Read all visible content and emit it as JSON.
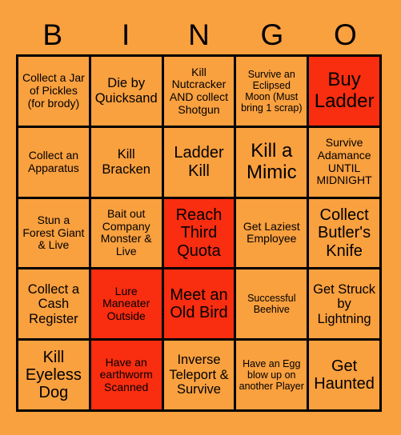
{
  "card": {
    "header_letters": [
      "B",
      "I",
      "N",
      "G",
      "O"
    ],
    "colors": {
      "background": "#f9a03f",
      "cell_unmarked": "#f9a03f",
      "cell_marked": "#f92d10",
      "border": "#000000",
      "text": "#000000"
    },
    "rows": [
      [
        {
          "text": "Collect a Jar of Pickles (for brody)",
          "marked": false,
          "size": "s"
        },
        {
          "text": "Die by Quicksand",
          "marked": false,
          "size": "m"
        },
        {
          "text": "Kill Nutcracker AND collect Shotgun",
          "marked": false,
          "size": "s"
        },
        {
          "text": "Survive an Eclipsed Moon (Must bring 1 scrap)",
          "marked": false,
          "size": "xs"
        },
        {
          "text": "Buy Ladder",
          "marked": true,
          "size": "xl"
        }
      ],
      [
        {
          "text": "Collect an Apparatus",
          "marked": false,
          "size": "s"
        },
        {
          "text": "Kill Bracken",
          "marked": false,
          "size": "m"
        },
        {
          "text": "Ladder Kill",
          "marked": false,
          "size": "l"
        },
        {
          "text": "Kill a Mimic",
          "marked": false,
          "size": "xl"
        },
        {
          "text": "Survive Adamance UNTIL MIDNIGHT",
          "marked": false,
          "size": "s"
        }
      ],
      [
        {
          "text": "Stun a Forest Giant & Live",
          "marked": false,
          "size": "s"
        },
        {
          "text": "Bait out Company Monster & Live",
          "marked": false,
          "size": "s"
        },
        {
          "text": "Reach Third Quota",
          "marked": true,
          "size": "l"
        },
        {
          "text": "Get Laziest Employee",
          "marked": false,
          "size": "s"
        },
        {
          "text": "Collect Butler's Knife",
          "marked": false,
          "size": "l"
        }
      ],
      [
        {
          "text": "Collect a Cash Register",
          "marked": false,
          "size": "m"
        },
        {
          "text": "Lure Maneater Outside",
          "marked": true,
          "size": "s"
        },
        {
          "text": "Meet an Old Bird",
          "marked": true,
          "size": "l"
        },
        {
          "text": "Successful Beehive",
          "marked": false,
          "size": "xs"
        },
        {
          "text": "Get Struck by Lightning",
          "marked": false,
          "size": "m"
        }
      ],
      [
        {
          "text": "Kill Eyeless Dog",
          "marked": false,
          "size": "l"
        },
        {
          "text": "Have an earthworm Scanned",
          "marked": true,
          "size": "s"
        },
        {
          "text": "Inverse Teleport & Survive",
          "marked": false,
          "size": "m"
        },
        {
          "text": "Have an Egg blow up on another Player",
          "marked": false,
          "size": "xs"
        },
        {
          "text": "Get Haunted",
          "marked": false,
          "size": "l"
        }
      ]
    ]
  }
}
